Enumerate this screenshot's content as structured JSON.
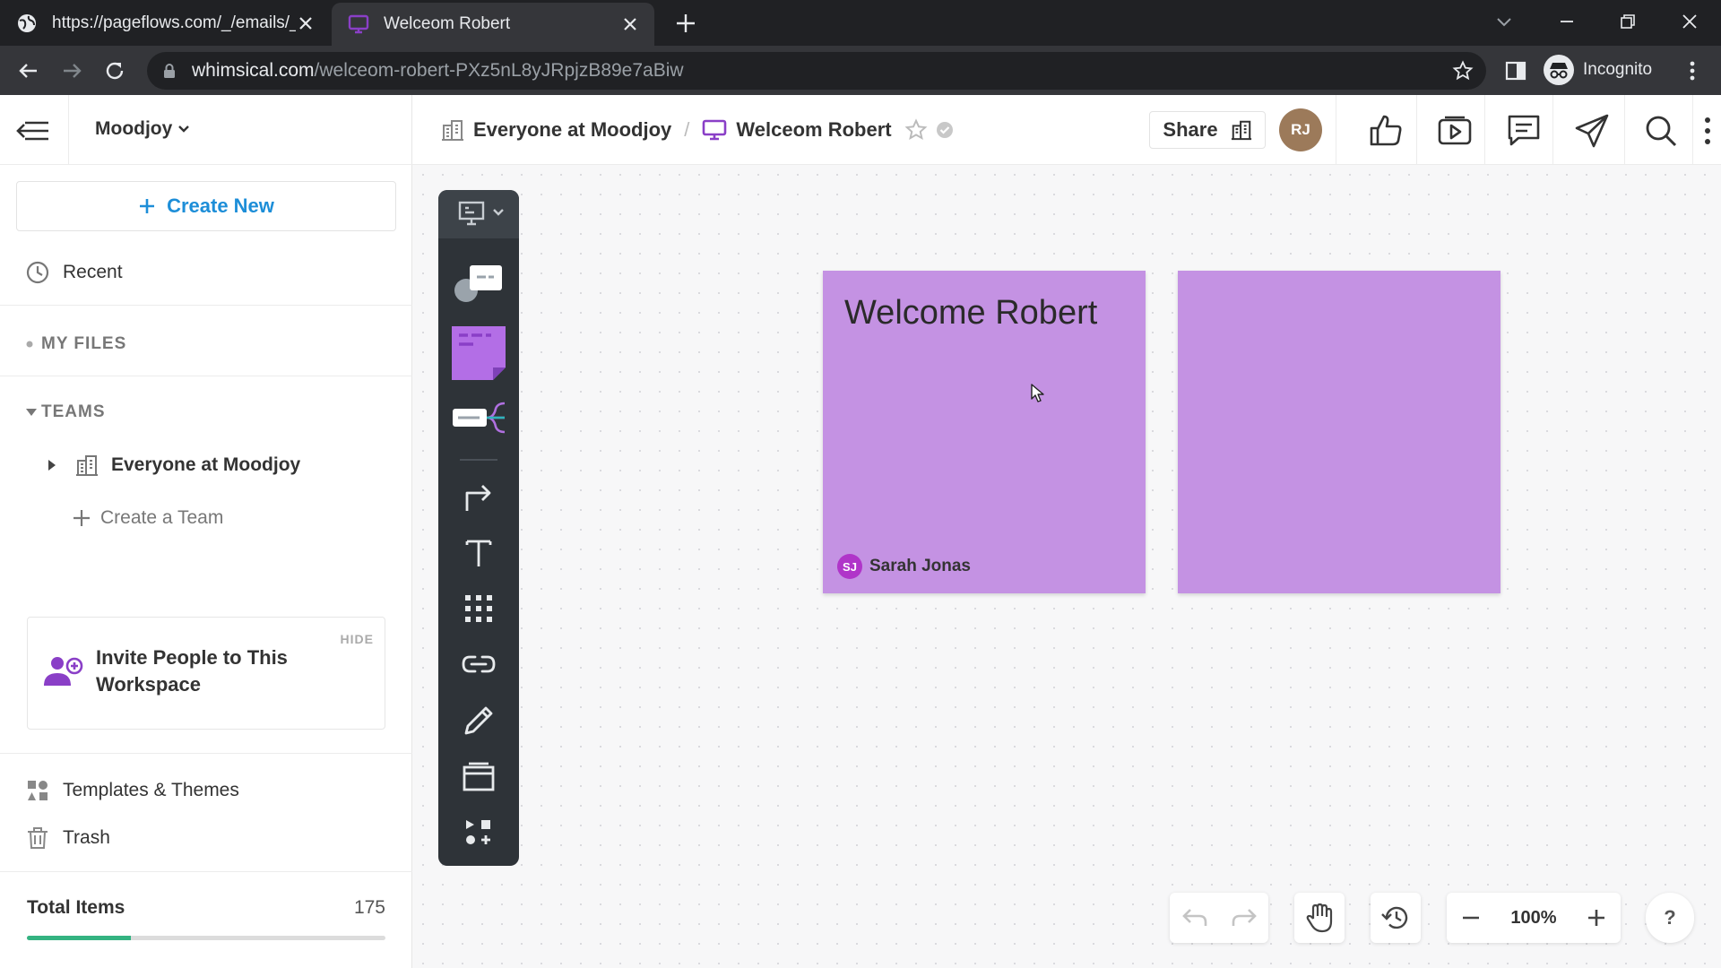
{
  "browser": {
    "tabs": [
      {
        "title": "https://pageflows.com/_/emails/_",
        "icon": "globe-icon"
      },
      {
        "title": "Welceom Robert",
        "icon": "presentation-board-icon"
      }
    ],
    "url_host": "whimsical.com",
    "url_path": "/welceom-robert-PXz5nL8yJRpjzB89e7aBiw",
    "profile_label": "Incognito"
  },
  "sidebar": {
    "workspace_name": "Moodjoy",
    "create_new_label": "Create New",
    "recent_label": "Recent",
    "my_files_label": "MY FILES",
    "teams_label": "TEAMS",
    "team_name": "Everyone at Moodjoy",
    "create_team_label": "Create a Team",
    "invite": {
      "hide_label": "HIDE",
      "text": "Invite People to This Workspace"
    },
    "templates_label": "Templates & Themes",
    "trash_label": "Trash",
    "total_items_label": "Total Items",
    "total_items_count": "175",
    "storage_used_fraction": 0.29
  },
  "topbar": {
    "breadcrumb_team": "Everyone at Moodjoy",
    "breadcrumb_board": "Welceom Robert",
    "share_label": "Share",
    "avatar_initials": "RJ"
  },
  "canvas": {
    "stickies": [
      {
        "text": "Welcome Robert",
        "author": "Sarah Jonas",
        "author_initials": "SJ"
      },
      {
        "text": ""
      }
    ],
    "sticky_color": "#c492e3",
    "zoom": "100%"
  },
  "colors": {
    "accent_blue": "#1d8ed8",
    "purple": "#8a3fc7",
    "progress_green": "#34b381",
    "toolbar_dark": "#2e3338"
  }
}
